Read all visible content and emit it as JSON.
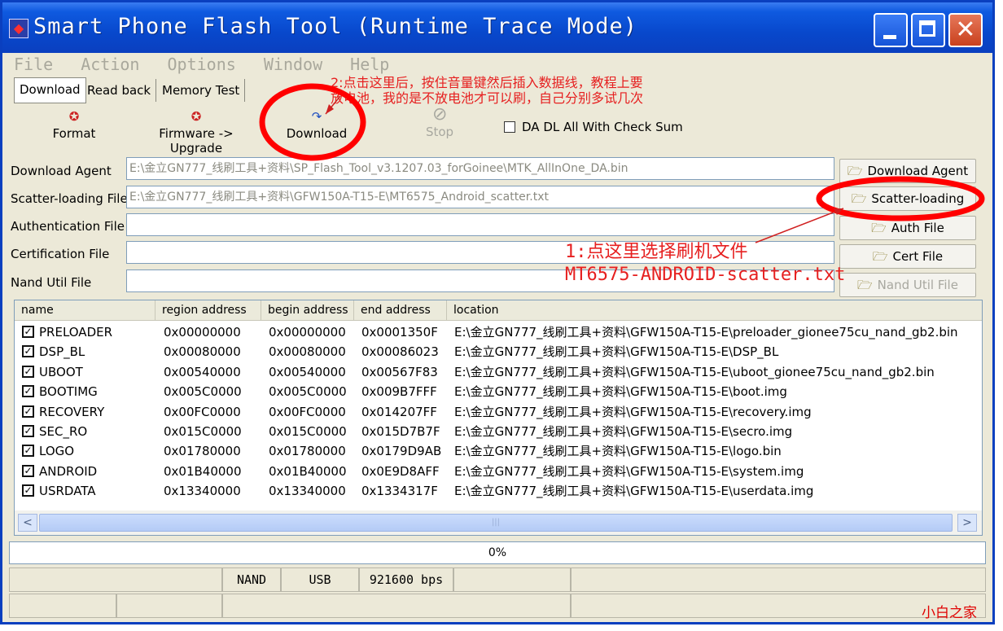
{
  "window": {
    "title": "Smart Phone Flash Tool (Runtime Trace Mode)",
    "minimize_icon": "minimize-icon",
    "maximize_icon": "maximize-icon",
    "close_icon": "close-icon"
  },
  "menu": [
    "File",
    "Action",
    "Options",
    "Window",
    "Help"
  ],
  "tabs": [
    "Download",
    "Read back",
    "Memory Test"
  ],
  "toolbar": {
    "format_label": "Format",
    "upgrade_label": "Firmware -> Upgrade",
    "download_label": "Download",
    "stop_label": "Stop",
    "checksum_label": "DA DL All With Check Sum"
  },
  "fields": {
    "download_agent": {
      "label": "Download Agent",
      "value": "E:\\金立GN777_线刷工具+资料\\SP_Flash_Tool_v3.1207.03_forGoinee\\MTK_AllInOne_DA.bin"
    },
    "scatter": {
      "label": "Scatter-loading File",
      "value": "E:\\金立GN777_线刷工具+资料\\GFW150A-T15-E\\MT6575_Android_scatter.txt"
    },
    "auth": {
      "label": "Authentication File",
      "value": ""
    },
    "cert": {
      "label": "Certification File",
      "value": ""
    },
    "nand": {
      "label": "Nand Util File",
      "value": ""
    }
  },
  "side_buttons": {
    "download_agent": "Download Agent",
    "scatter_loading": "Scatter-loading",
    "auth_file": "Auth File",
    "cert_file": "Cert File",
    "nand_util": "Nand Util File"
  },
  "table": {
    "columns": [
      "name",
      "region address",
      "begin address",
      "end address",
      "location"
    ],
    "rows": [
      {
        "name": "PRELOADER",
        "region": "0x00000000",
        "begin": "0x00000000",
        "end": "0x0001350F",
        "location": "E:\\金立GN777_线刷工具+资料\\GFW150A-T15-E\\preloader_gionee75cu_nand_gb2.bin"
      },
      {
        "name": "DSP_BL",
        "region": "0x00080000",
        "begin": "0x00080000",
        "end": "0x00086023",
        "location": "E:\\金立GN777_线刷工具+资料\\GFW150A-T15-E\\DSP_BL"
      },
      {
        "name": "UBOOT",
        "region": "0x00540000",
        "begin": "0x00540000",
        "end": "0x00567F83",
        "location": "E:\\金立GN777_线刷工具+资料\\GFW150A-T15-E\\uboot_gionee75cu_nand_gb2.bin"
      },
      {
        "name": "BOOTIMG",
        "region": "0x005C0000",
        "begin": "0x005C0000",
        "end": "0x009B7FFF",
        "location": "E:\\金立GN777_线刷工具+资料\\GFW150A-T15-E\\boot.img"
      },
      {
        "name": "RECOVERY",
        "region": "0x00FC0000",
        "begin": "0x00FC0000",
        "end": "0x014207FF",
        "location": "E:\\金立GN777_线刷工具+资料\\GFW150A-T15-E\\recovery.img"
      },
      {
        "name": "SEC_RO",
        "region": "0x015C0000",
        "begin": "0x015C0000",
        "end": "0x015D7B7F",
        "location": "E:\\金立GN777_线刷工具+资料\\GFW150A-T15-E\\secro.img"
      },
      {
        "name": "LOGO",
        "region": "0x01780000",
        "begin": "0x01780000",
        "end": "0x0179D9AB",
        "location": "E:\\金立GN777_线刷工具+资料\\GFW150A-T15-E\\logo.bin"
      },
      {
        "name": "ANDROID",
        "region": "0x01B40000",
        "begin": "0x01B40000",
        "end": "0x0E9D8AFF",
        "location": "E:\\金立GN777_线刷工具+资料\\GFW150A-T15-E\\system.img"
      },
      {
        "name": "USRDATA",
        "region": "0x13340000",
        "begin": "0x13340000",
        "end": "0x1334317F",
        "location": "E:\\金立GN777_线刷工具+资料\\GFW150A-T15-E\\userdata.img"
      }
    ]
  },
  "progress": {
    "text": "0%",
    "fraction": 0.0
  },
  "status": {
    "storage": "NAND",
    "connection": "USB",
    "baud": "921600 bps"
  },
  "annotations": {
    "note2_line1": "2:点击这里后，按住音量键然后插入数据线，教程上要",
    "note2_line2": "放电池，我的是不放电池才可以刷，自己分别多试几次",
    "note1_line1": "1:点这里选择刷机文件",
    "note1_line2": "MT6575-ANDROID-scatter.txt",
    "watermark": "小白之家"
  },
  "colors": {
    "titlebar": "#0a48cc",
    "annotation": "#e62020",
    "window_bg": "#ece9d8"
  }
}
